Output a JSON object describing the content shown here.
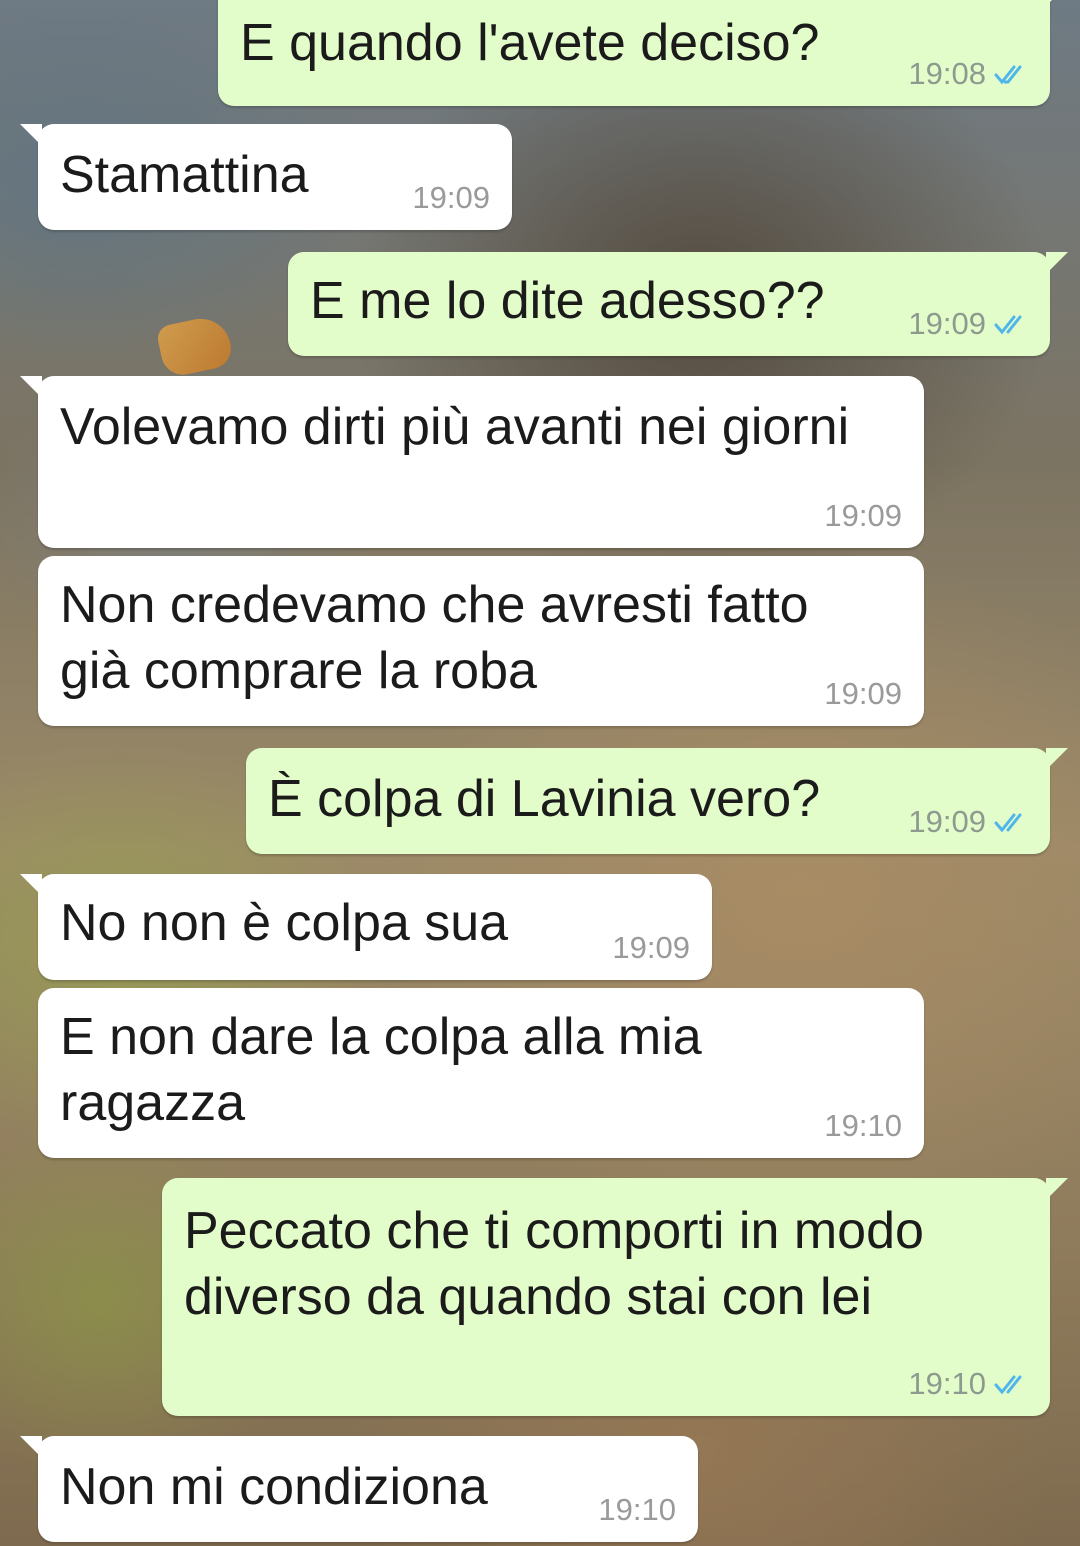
{
  "colors": {
    "incoming_bubble": "#ffffff",
    "outgoing_bubble": "#e2fdc9",
    "read_ticks": "#4fb6ec"
  },
  "messages": [
    {
      "direction": "out",
      "text": "E quando l'avete deciso?",
      "time": "19:08",
      "status": "read-ticks-icon"
    },
    {
      "direction": "in",
      "text": "Stamattina",
      "time": "19:09"
    },
    {
      "direction": "out",
      "text": "E me lo dite adesso??",
      "time": "19:09",
      "status": "read-ticks-icon"
    },
    {
      "direction": "in",
      "text": "Volevamo dirti più avanti nei giorni",
      "time": "19:09"
    },
    {
      "direction": "in",
      "text": "Non credevamo che avresti fatto\ngià comprare la roba",
      "time": "19:09"
    },
    {
      "direction": "out",
      "text": "È colpa di Lavinia vero?",
      "time": "19:09",
      "status": "read-ticks-icon"
    },
    {
      "direction": "in",
      "text": "No non è colpa sua",
      "time": "19:09"
    },
    {
      "direction": "in",
      "text": "E non dare la colpa alla mia\nragazza",
      "time": "19:10"
    },
    {
      "direction": "out",
      "text": "Peccato che ti comporti in modo\ndiverso da quando stai con lei",
      "time": "19:10",
      "status": "read-ticks-icon"
    },
    {
      "direction": "in",
      "text": "Non mi condiziona",
      "time": "19:10"
    }
  ]
}
